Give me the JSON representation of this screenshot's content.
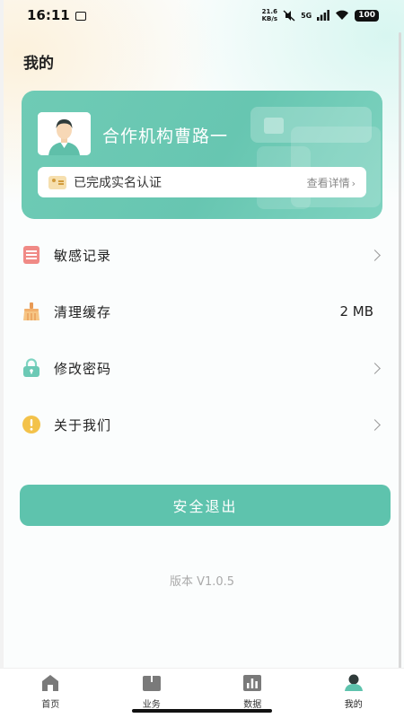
{
  "status_bar": {
    "time": "16:11",
    "net_speed_value": "21.6",
    "net_speed_unit": "KB/s",
    "network": "5G",
    "battery": "100"
  },
  "page": {
    "title": "我的"
  },
  "profile": {
    "org_name": "合作机构曹路一",
    "verify_text": "已完成实名认证",
    "detail_link": "查看详情"
  },
  "menu": {
    "items": [
      {
        "label": "敏感记录",
        "icon": "record-icon"
      },
      {
        "label": "清理缓存",
        "icon": "broom-icon",
        "value": "2 MB"
      },
      {
        "label": "修改密码",
        "icon": "lock-icon"
      },
      {
        "label": "关于我们",
        "icon": "info-icon"
      }
    ]
  },
  "logout": {
    "label": "安全退出"
  },
  "version": "版本 V1.0.5",
  "bottom_nav": {
    "items": [
      {
        "label": "首页",
        "icon": "home-icon"
      },
      {
        "label": "业务",
        "icon": "business-icon"
      },
      {
        "label": "数据",
        "icon": "data-icon"
      },
      {
        "label": "我的",
        "icon": "profile-icon",
        "active": true
      }
    ]
  },
  "colors": {
    "accent": "#5ec3ad",
    "card": "#6fcbb5",
    "nav_inactive": "#7a7a7a"
  }
}
